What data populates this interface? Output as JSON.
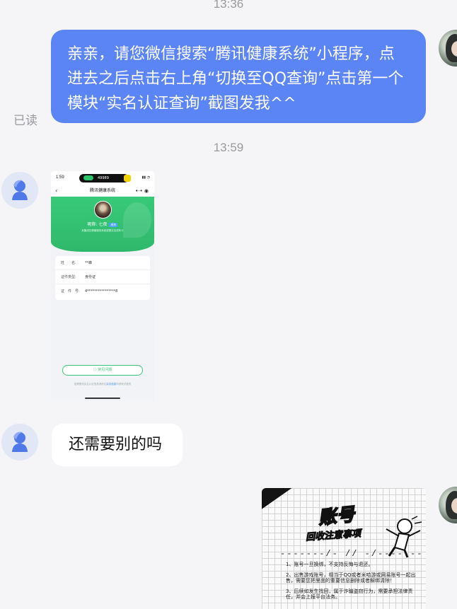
{
  "timestamps": [
    "13:36",
    "13:59"
  ],
  "messages": {
    "outgoing_text": "亲亲，请您微信搜索“腾讯健康系统”小程序，点进去之后点击右上角“切换至QQ查询”点击第一个模块“实名认证查询”截图发我^^",
    "read_status": "已读",
    "incoming_text": "还需要别的吗"
  },
  "screenshot": {
    "status_time": "1:59",
    "status_pill": "49989",
    "page_title": "腾讯健康系统",
    "nickname_label": "昵称: ",
    "nickname_value": "七夜",
    "badge": "成年",
    "hero_sub": "未集成在健康服务系统或是实名成年人",
    "rows": [
      {
        "label": "姓　　名:",
        "value": "**峰"
      },
      {
        "label": "证件类型:",
        "value": "身份证"
      },
      {
        "label": "证　件　号:",
        "value": "4****************8"
      }
    ],
    "faq_button": "ⓘ 常见问题",
    "footer_prefix": "如需更改实名认证信息请前往",
    "footer_link": "实名信息",
    "footer_suffix": "申请有关更改"
  },
  "poster": {
    "title": "账号",
    "subtitle": "回收注意事项",
    "divider": "-------/-  //  -/-------",
    "items": [
      "1、账号一旦换绑，不支持反悔与退还。",
      "2、出售游戏账号，相当于QQ或者米哈游或网易账号一起出售，需要您把里面的重要信息删除或者解绑清除！",
      "3、后续如发生找回，属于诈骗盗窃行为，需要承担法律责任，并会上报平台法务。"
    ]
  }
}
